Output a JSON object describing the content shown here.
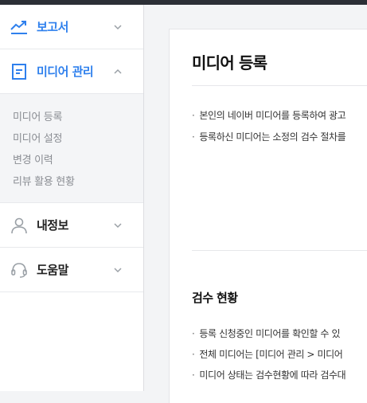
{
  "sidebar": {
    "items": [
      {
        "label": "보고서",
        "icon": "trend-chart-icon",
        "expanded": false
      },
      {
        "label": "미디어 관리",
        "icon": "document-icon",
        "expanded": true,
        "subitems": [
          "미디어 등록",
          "미디어 설정",
          "변경 이력",
          "리뷰 활용 현황"
        ]
      },
      {
        "label": "내정보",
        "icon": "user-icon",
        "expanded": false
      },
      {
        "label": "도움말",
        "icon": "headset-icon",
        "expanded": false
      }
    ]
  },
  "main": {
    "title": "미디어 등록",
    "intro_bullets": [
      "본인의 네이버 미디어를 등록하여 광고",
      "등록하신 미디어는 소정의 검수 절차를"
    ],
    "section_title": "검수 현황",
    "section_bullets": [
      "등록 신청중인 미디어를 확인할 수 있",
      "전체 미디어는 [미디어 관리 > 미디어",
      "미디어 상태는 검수현황에 따라 검수대"
    ]
  },
  "colors": {
    "accent": "#2f80ed",
    "topbar": "#2c2f36",
    "sidebar_bg": "#ffffff",
    "submenu_bg": "#f4f5f7"
  }
}
